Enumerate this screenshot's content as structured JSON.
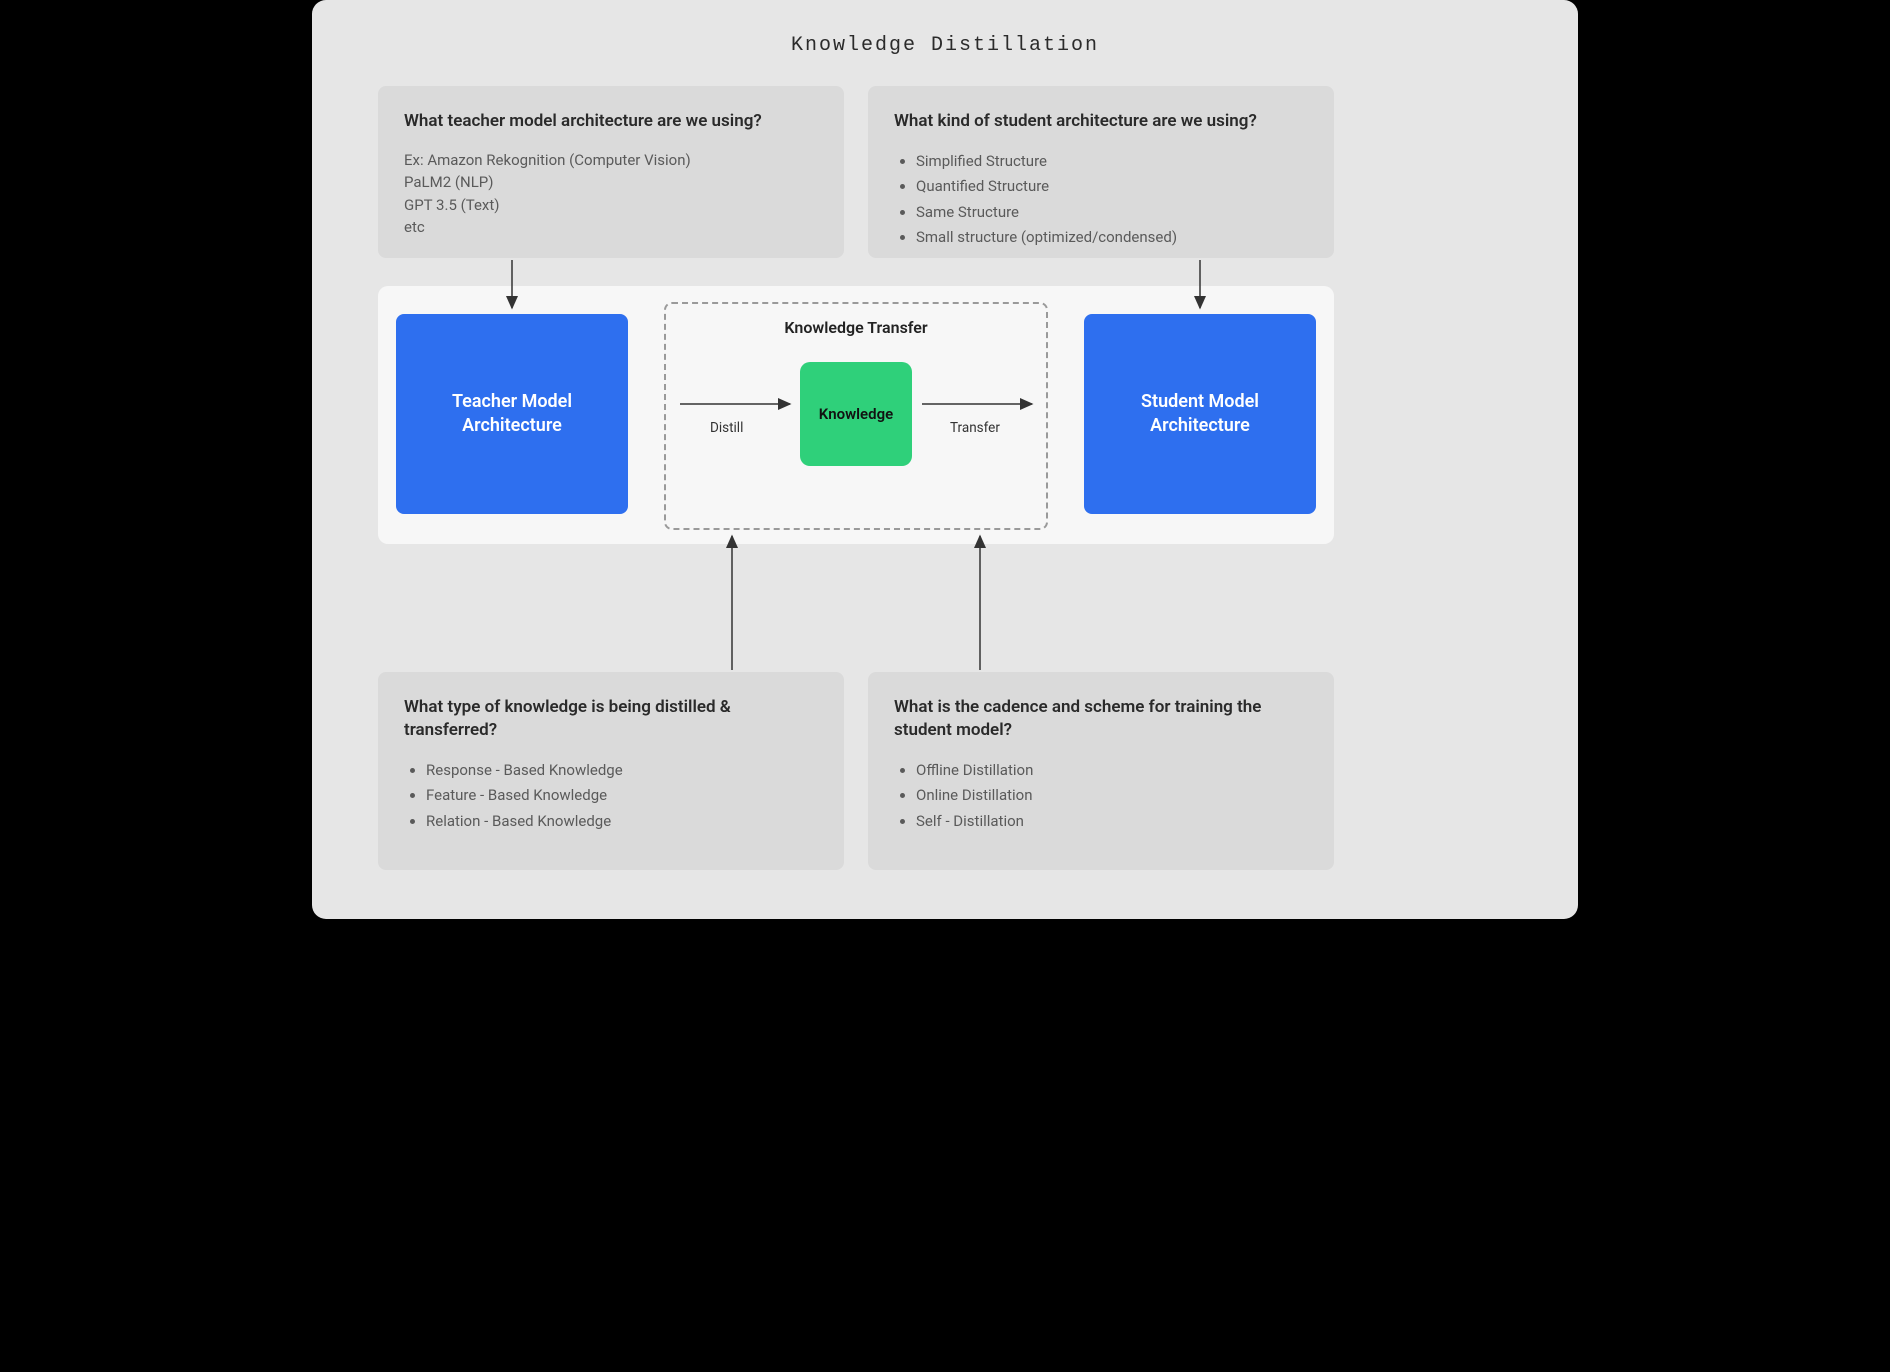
{
  "title": "Knowledge Distillation",
  "cards": {
    "top_left": {
      "heading": "What teacher model architecture are we using?",
      "lines": [
        "Ex: Amazon Rekognition (Computer Vision)",
        "PaLM2 (NLP)",
        "GPT 3.5 (Text)",
        "etc"
      ]
    },
    "top_right": {
      "heading": "What kind of student architecture are we using?",
      "items": [
        "Simplified Structure",
        "Quantified Structure",
        "Same Structure",
        "Small structure (optimized/condensed)"
      ]
    },
    "bottom_left": {
      "heading": "What type of knowledge is being distilled & transferred?",
      "items": [
        "Response - Based Knowledge",
        "Feature - Based Knowledge",
        "Relation - Based Knowledge"
      ]
    },
    "bottom_right": {
      "heading": "What is the cadence and scheme for training the student model?",
      "items": [
        "Offline Distillation",
        "Online Distillation",
        "Self - Distillation"
      ]
    }
  },
  "flow": {
    "teacher_box": "Teacher Model Architecture",
    "student_box": "Student Model Architecture",
    "knowledge_box": "Knowledge",
    "transfer_heading": "Knowledge Transfer",
    "distill_label": "Distill",
    "transfer_label": "Transfer"
  }
}
